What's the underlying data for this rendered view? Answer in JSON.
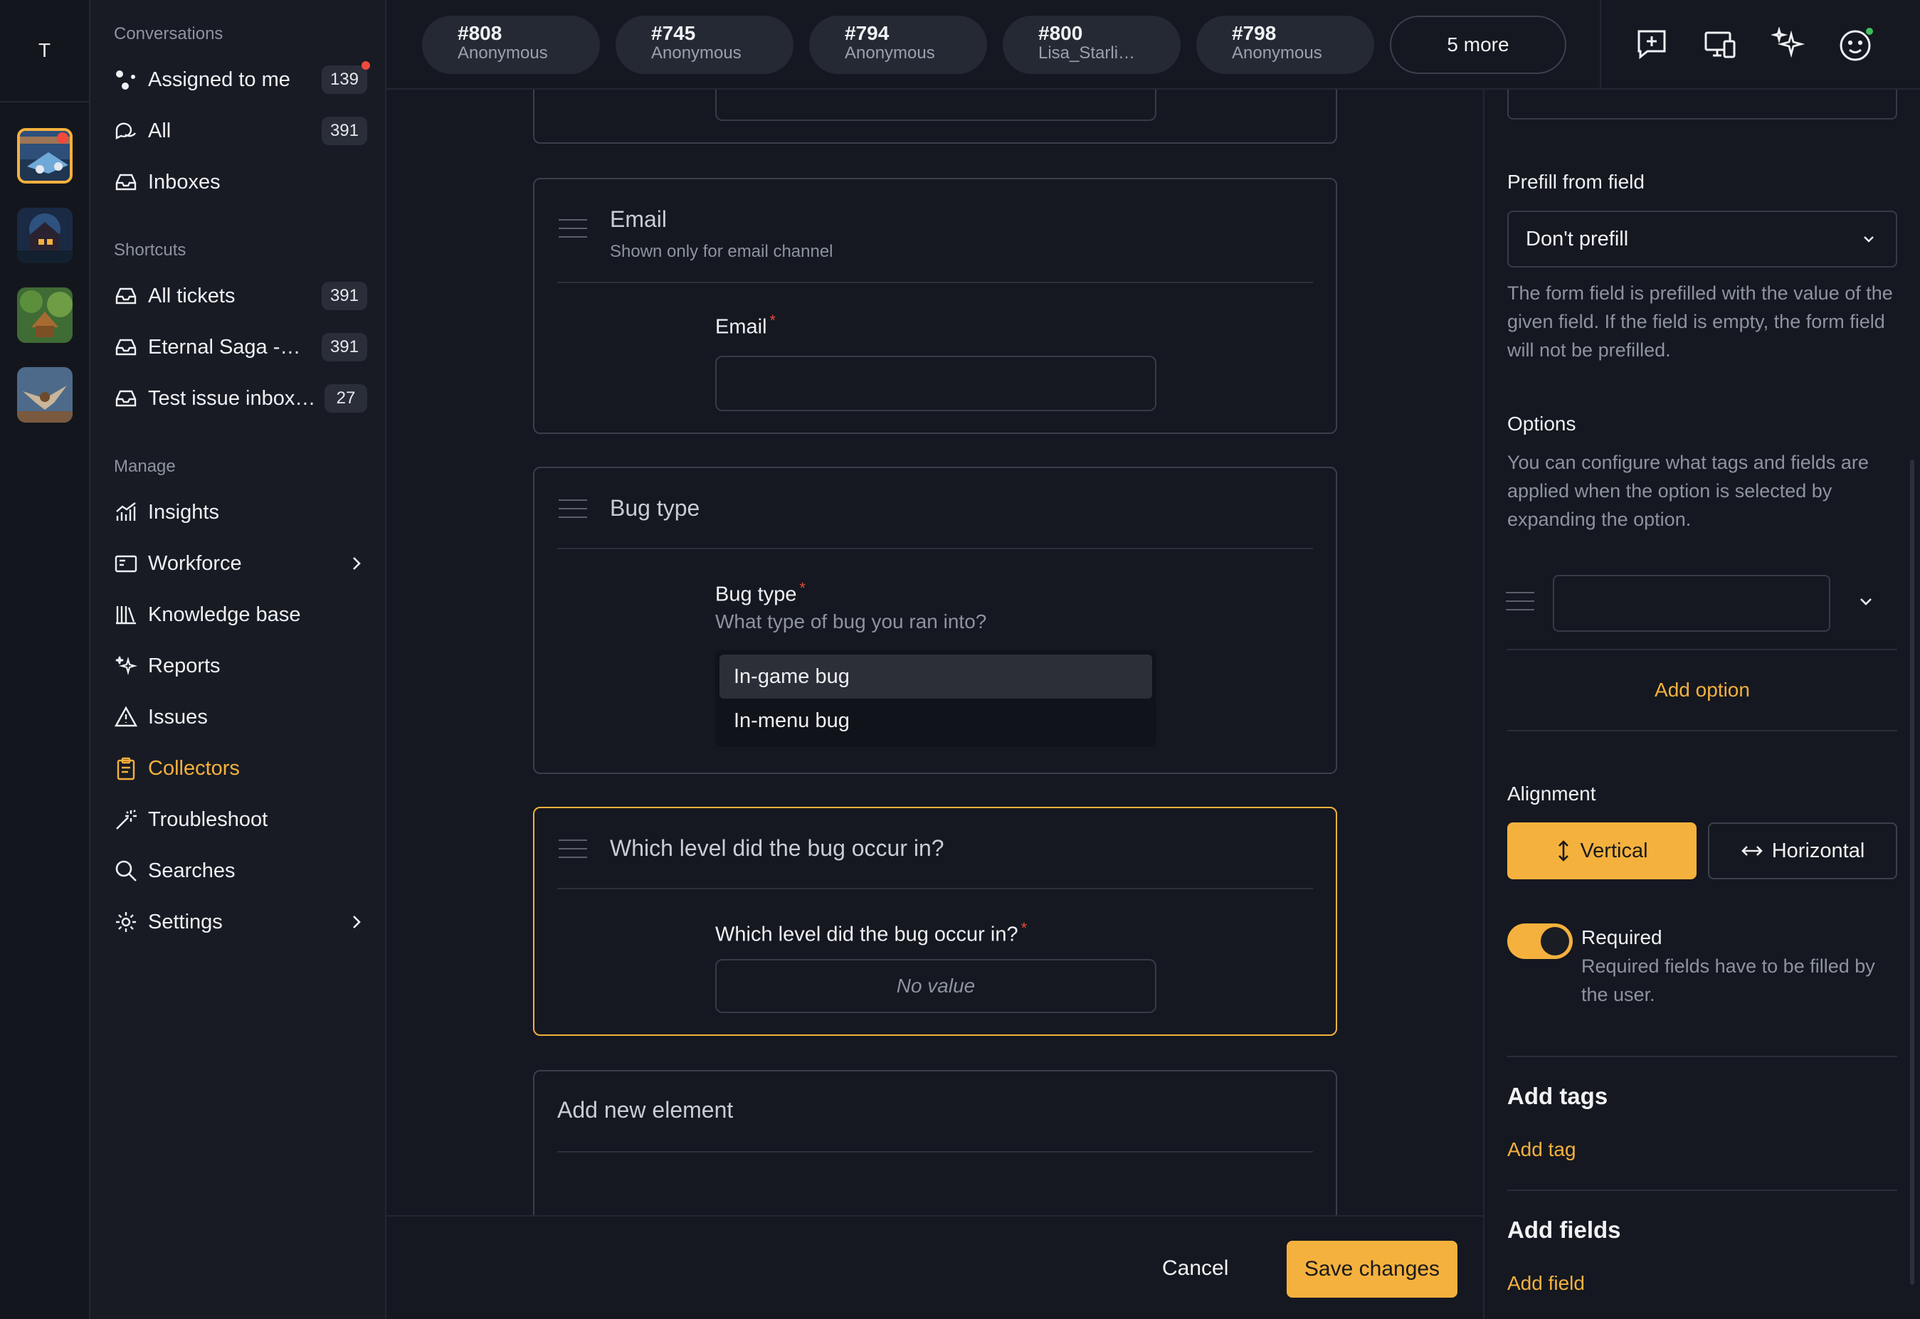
{
  "workspace": {
    "initial": "T"
  },
  "sidebar": {
    "conversations_label": "Conversations",
    "shortcuts_label": "Shortcuts",
    "manage_label": "Manage",
    "conversations": [
      {
        "label": "Assigned to me",
        "count": "139"
      },
      {
        "label": "All",
        "count": "391"
      },
      {
        "label": "Inboxes"
      }
    ],
    "shortcuts": [
      {
        "label": "All tickets",
        "count": "391"
      },
      {
        "label": "Eternal Saga -…",
        "count": "391"
      },
      {
        "label": "Test issue inbox…",
        "count": "27"
      }
    ],
    "manage": [
      {
        "label": "Insights"
      },
      {
        "label": "Workforce"
      },
      {
        "label": "Knowledge base"
      },
      {
        "label": "Reports"
      },
      {
        "label": "Issues"
      },
      {
        "label": "Collectors"
      },
      {
        "label": "Troubleshoot"
      },
      {
        "label": "Searches"
      },
      {
        "label": "Settings"
      }
    ]
  },
  "tabs": [
    {
      "num": "#808",
      "who": "Anonymous"
    },
    {
      "num": "#745",
      "who": "Anonymous"
    },
    {
      "num": "#794",
      "who": "Anonymous"
    },
    {
      "num": "#800",
      "who": "Lisa_Starli…"
    },
    {
      "num": "#798",
      "who": "Anonymous"
    }
  ],
  "more_tabs": "5 more",
  "form": {
    "email_card": {
      "title": "Email",
      "subtitle": "Shown only for email channel",
      "field_label": "Email"
    },
    "bug_card": {
      "title": "Bug type",
      "field_label": "Bug type",
      "help": "What type of bug you ran into?",
      "options": [
        "In-game bug",
        "In-menu bug"
      ]
    },
    "level_card": {
      "title": "Which level did the bug occur in?",
      "field_label": "Which level did the bug occur in?",
      "placeholder": "No value"
    },
    "add_element": "Add new element"
  },
  "actions": {
    "cancel": "Cancel",
    "save": "Save changes"
  },
  "panel": {
    "prefill_label": "Prefill from field",
    "prefill_value": "Don't prefill",
    "prefill_help": "The form field is prefilled with the value of the given field. If the field is empty, the form field will not be prefilled.",
    "options_label": "Options",
    "options_help": "You can configure what tags and fields are applied when the option is selected by expanding the option.",
    "add_option": "Add option",
    "alignment_label": "Alignment",
    "align_vertical": "Vertical",
    "align_horizontal": "Horizontal",
    "required_label": "Required",
    "required_help": "Required fields have to be filled by the user.",
    "required_on": true,
    "add_tags_heading": "Add tags",
    "add_tag": "Add tag",
    "add_fields_heading": "Add fields",
    "add_field": "Add field"
  },
  "colors": {
    "accent": "#f5b13d",
    "required_star": "#e2483d",
    "notification": "#ef4a3c",
    "online": "#3fbf5a"
  }
}
